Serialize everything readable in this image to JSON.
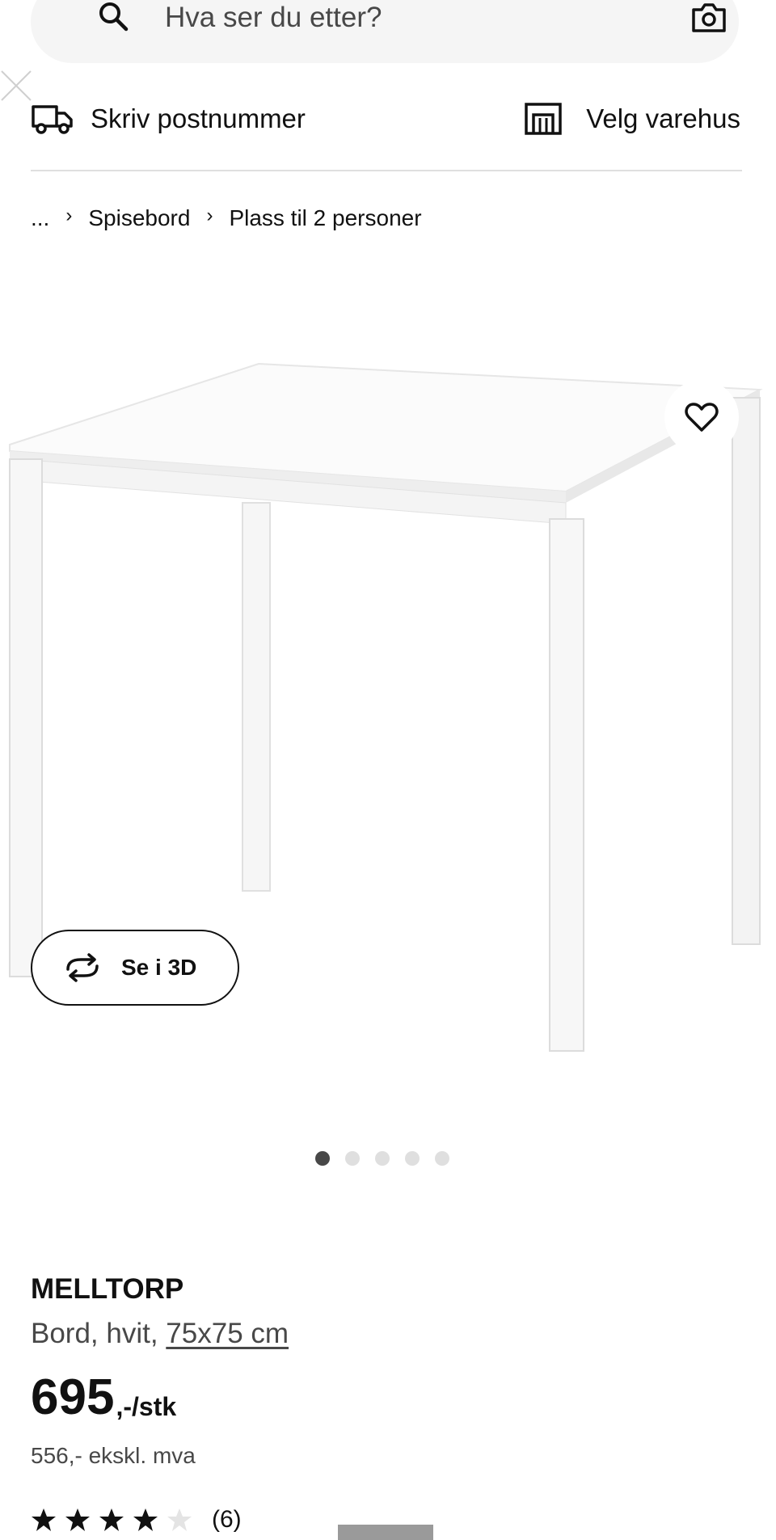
{
  "search": {
    "placeholder": "Hva ser du etter?",
    "search_icon": "search-icon",
    "camera_icon": "camera-icon"
  },
  "delivery": {
    "postcode_label": "Skriv postnummer",
    "store_label": "Velg varehus",
    "truck_icon": "truck-icon",
    "store_icon": "store-icon"
  },
  "breadcrumb": {
    "items": [
      "...",
      "Spisebord",
      "Plass til 2 personer"
    ]
  },
  "gallery": {
    "view3d_label": "Se i 3D",
    "dots_total": 5,
    "active_dot": 1
  },
  "product": {
    "name": "MELLTORP",
    "description_prefix": "Bord, hvit, ",
    "size_link": "75x75 cm",
    "price": "695",
    "price_unit": ",-/stk",
    "price_ex_vat": "556,- ekskl. mva",
    "rating": 4,
    "rating_max": 5,
    "review_count": "(6)"
  },
  "colors": {
    "text_primary": "#111111",
    "text_secondary": "#484848",
    "search_bg": "#f5f5f5",
    "divider": "#dfdfdf",
    "dot_active": "#484848",
    "dot_inactive": "#dfdfdf"
  }
}
